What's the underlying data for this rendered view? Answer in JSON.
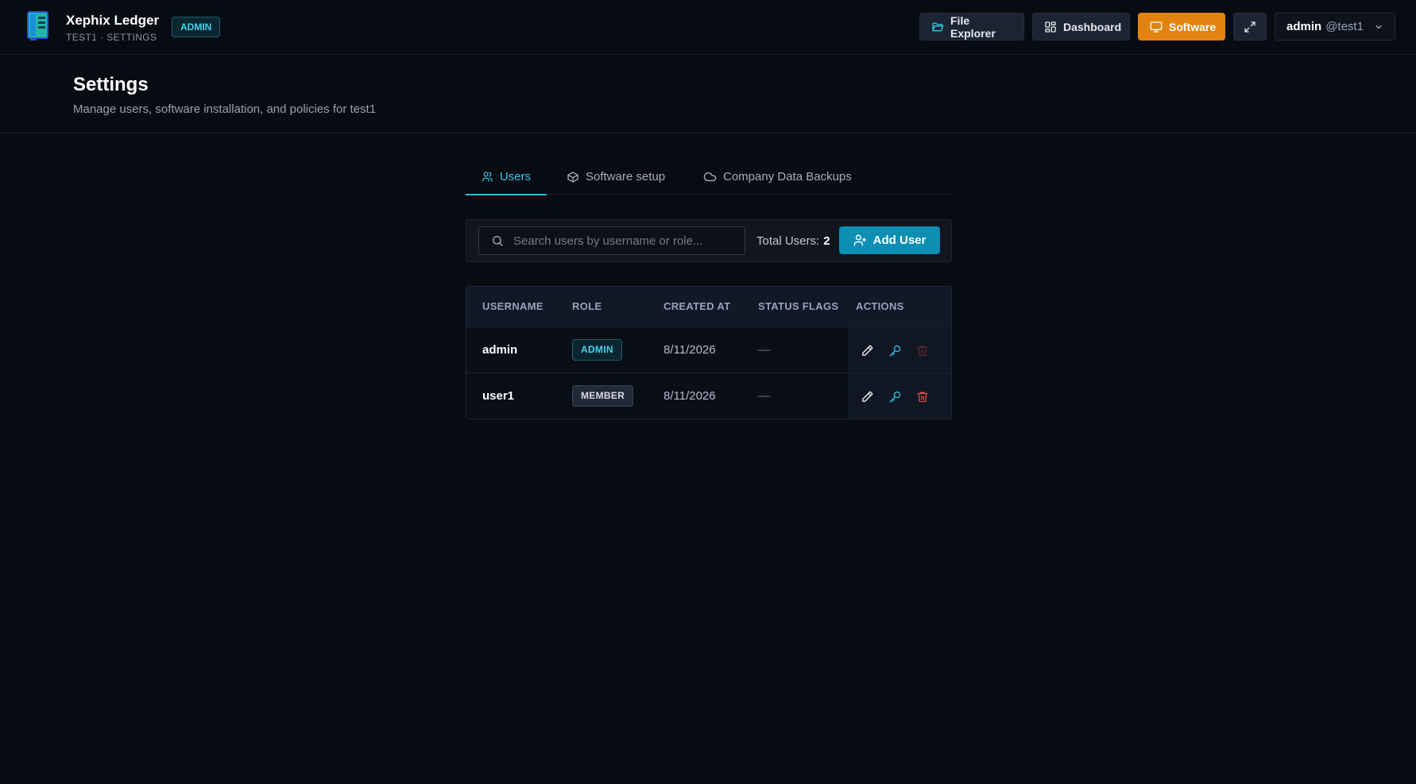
{
  "app": {
    "title": "Xephix Ledger",
    "subtitle": "TEST1 · SETTINGS",
    "role_badge": "ADMIN"
  },
  "nav": {
    "file_explorer": "File Explorer",
    "dashboard": "Dashboard",
    "software": "Software"
  },
  "user_menu": {
    "username": "admin",
    "company": "@test1"
  },
  "page": {
    "title": "Settings",
    "subtitle": "Manage users, software installation, and policies for test1"
  },
  "tabs": [
    {
      "label": "Users",
      "icon": "users-icon",
      "active": true
    },
    {
      "label": "Software setup",
      "icon": "package-icon",
      "active": false
    },
    {
      "label": "Company Data Backups",
      "icon": "cloud-icon",
      "active": false
    }
  ],
  "toolbar": {
    "search_placeholder": "Search users by username or role...",
    "total_label": "Total Users:",
    "total_value": "2",
    "add_user_label": "Add User"
  },
  "table": {
    "columns": [
      "USERNAME",
      "ROLE",
      "CREATED AT",
      "STATUS FLAGS",
      "ACTIONS"
    ],
    "rows": [
      {
        "username": "admin",
        "role": "ADMIN",
        "created_at": "8/11/2026",
        "status_flags": "—",
        "delete_enabled": false
      },
      {
        "username": "user1",
        "role": "MEMBER",
        "created_at": "8/11/2026",
        "status_flags": "—",
        "delete_enabled": true
      }
    ]
  },
  "colors": {
    "background": "#080b12",
    "accent_cyan": "#2ab8d8",
    "software_orange": "#e3830f",
    "add_user_blue": "#0f8eb3",
    "delete_red": "#e04848"
  }
}
